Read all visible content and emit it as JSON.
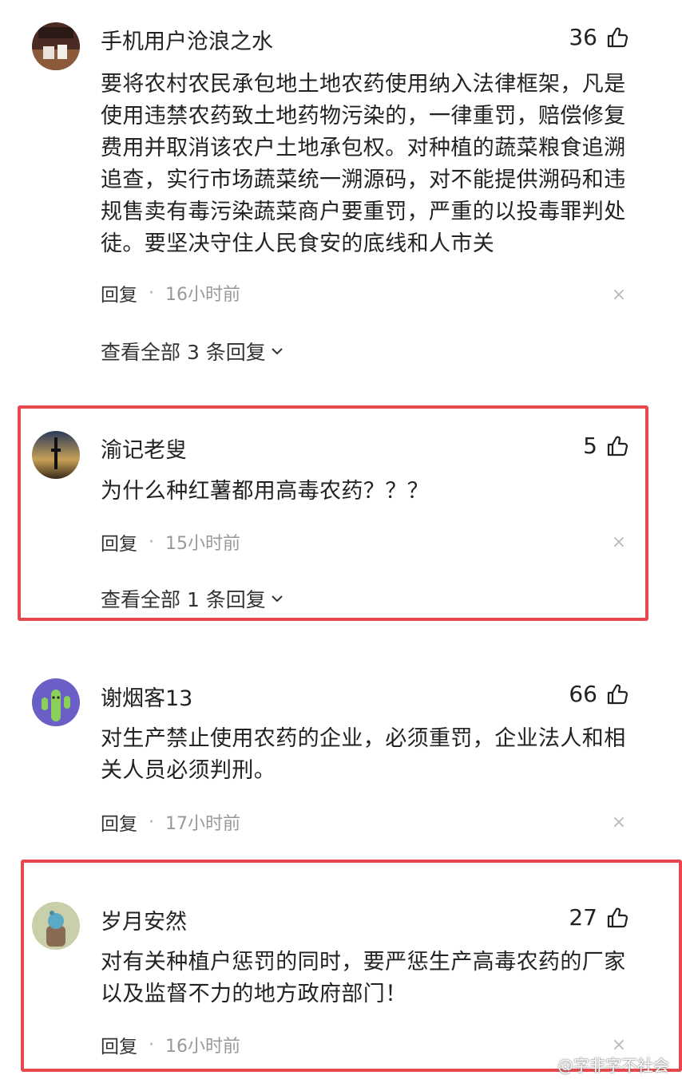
{
  "comments": [
    {
      "username": "手机用户沧浪之水",
      "likes": "36",
      "text": "要将农村农民承包地土地农药使用纳入法律框架，凡是使用违禁农药致土地药物污染的，一律重罚，赔偿修复费用并取消该农户土地承包权。对种植的蔬菜粮食追溯追查，实行市场蔬菜统一溯源码，对不能提供溯码和违规售卖有毒污染蔬菜商户要重罚，严重的以投毒罪判处徒。要坚决守住人民食安的底线和人市关",
      "reply_label": "回复",
      "time": "16小时前",
      "view_all": "查看全部 3 条回复"
    },
    {
      "username": "渝记老叟",
      "likes": "5",
      "text": "为什么种红薯都用高毒农药？？？",
      "reply_label": "回复",
      "time": "15小时前",
      "view_all": "查看全部 1 条回复"
    },
    {
      "username": "谢烟客13",
      "likes": "66",
      "text": "对生产禁止使用农药的企业，必须重罚，企业法人和相关人员必须判刑。",
      "reply_label": "回复",
      "time": "17小时前"
    },
    {
      "username": "岁月安然",
      "likes": "27",
      "text": "对有关种植户惩罚的同时，要严惩生产高毒农药的厂家以及监督不力的地方政府部门！",
      "reply_label": "回复",
      "time": "16小时前"
    }
  ],
  "watermark": "@字非字不社会",
  "icons": {
    "like": "thumbs-up-icon",
    "close": "close-icon",
    "chevron": "chevron-down-icon"
  },
  "colors": {
    "highlight_border": "#e5484d",
    "meta_text": "#999999"
  }
}
